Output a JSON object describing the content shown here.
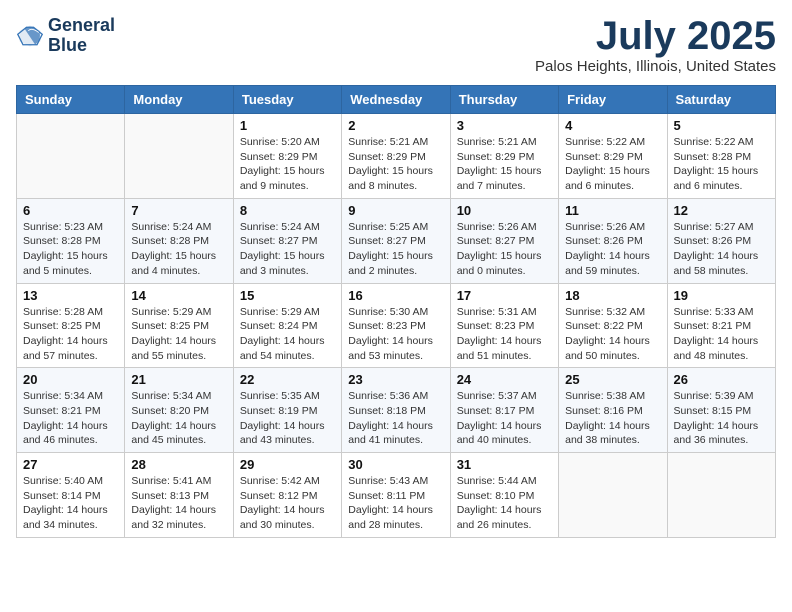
{
  "header": {
    "logo": {
      "line1": "General",
      "line2": "Blue"
    },
    "month": "July 2025",
    "location": "Palos Heights, Illinois, United States"
  },
  "days_of_week": [
    "Sunday",
    "Monday",
    "Tuesday",
    "Wednesday",
    "Thursday",
    "Friday",
    "Saturday"
  ],
  "weeks": [
    [
      {
        "day": "",
        "info": ""
      },
      {
        "day": "",
        "info": ""
      },
      {
        "day": "1",
        "info": "Sunrise: 5:20 AM\nSunset: 8:29 PM\nDaylight: 15 hours and 9 minutes."
      },
      {
        "day": "2",
        "info": "Sunrise: 5:21 AM\nSunset: 8:29 PM\nDaylight: 15 hours and 8 minutes."
      },
      {
        "day": "3",
        "info": "Sunrise: 5:21 AM\nSunset: 8:29 PM\nDaylight: 15 hours and 7 minutes."
      },
      {
        "day": "4",
        "info": "Sunrise: 5:22 AM\nSunset: 8:29 PM\nDaylight: 15 hours and 6 minutes."
      },
      {
        "day": "5",
        "info": "Sunrise: 5:22 AM\nSunset: 8:28 PM\nDaylight: 15 hours and 6 minutes."
      }
    ],
    [
      {
        "day": "6",
        "info": "Sunrise: 5:23 AM\nSunset: 8:28 PM\nDaylight: 15 hours and 5 minutes."
      },
      {
        "day": "7",
        "info": "Sunrise: 5:24 AM\nSunset: 8:28 PM\nDaylight: 15 hours and 4 minutes."
      },
      {
        "day": "8",
        "info": "Sunrise: 5:24 AM\nSunset: 8:27 PM\nDaylight: 15 hours and 3 minutes."
      },
      {
        "day": "9",
        "info": "Sunrise: 5:25 AM\nSunset: 8:27 PM\nDaylight: 15 hours and 2 minutes."
      },
      {
        "day": "10",
        "info": "Sunrise: 5:26 AM\nSunset: 8:27 PM\nDaylight: 15 hours and 0 minutes."
      },
      {
        "day": "11",
        "info": "Sunrise: 5:26 AM\nSunset: 8:26 PM\nDaylight: 14 hours and 59 minutes."
      },
      {
        "day": "12",
        "info": "Sunrise: 5:27 AM\nSunset: 8:26 PM\nDaylight: 14 hours and 58 minutes."
      }
    ],
    [
      {
        "day": "13",
        "info": "Sunrise: 5:28 AM\nSunset: 8:25 PM\nDaylight: 14 hours and 57 minutes."
      },
      {
        "day": "14",
        "info": "Sunrise: 5:29 AM\nSunset: 8:25 PM\nDaylight: 14 hours and 55 minutes."
      },
      {
        "day": "15",
        "info": "Sunrise: 5:29 AM\nSunset: 8:24 PM\nDaylight: 14 hours and 54 minutes."
      },
      {
        "day": "16",
        "info": "Sunrise: 5:30 AM\nSunset: 8:23 PM\nDaylight: 14 hours and 53 minutes."
      },
      {
        "day": "17",
        "info": "Sunrise: 5:31 AM\nSunset: 8:23 PM\nDaylight: 14 hours and 51 minutes."
      },
      {
        "day": "18",
        "info": "Sunrise: 5:32 AM\nSunset: 8:22 PM\nDaylight: 14 hours and 50 minutes."
      },
      {
        "day": "19",
        "info": "Sunrise: 5:33 AM\nSunset: 8:21 PM\nDaylight: 14 hours and 48 minutes."
      }
    ],
    [
      {
        "day": "20",
        "info": "Sunrise: 5:34 AM\nSunset: 8:21 PM\nDaylight: 14 hours and 46 minutes."
      },
      {
        "day": "21",
        "info": "Sunrise: 5:34 AM\nSunset: 8:20 PM\nDaylight: 14 hours and 45 minutes."
      },
      {
        "day": "22",
        "info": "Sunrise: 5:35 AM\nSunset: 8:19 PM\nDaylight: 14 hours and 43 minutes."
      },
      {
        "day": "23",
        "info": "Sunrise: 5:36 AM\nSunset: 8:18 PM\nDaylight: 14 hours and 41 minutes."
      },
      {
        "day": "24",
        "info": "Sunrise: 5:37 AM\nSunset: 8:17 PM\nDaylight: 14 hours and 40 minutes."
      },
      {
        "day": "25",
        "info": "Sunrise: 5:38 AM\nSunset: 8:16 PM\nDaylight: 14 hours and 38 minutes."
      },
      {
        "day": "26",
        "info": "Sunrise: 5:39 AM\nSunset: 8:15 PM\nDaylight: 14 hours and 36 minutes."
      }
    ],
    [
      {
        "day": "27",
        "info": "Sunrise: 5:40 AM\nSunset: 8:14 PM\nDaylight: 14 hours and 34 minutes."
      },
      {
        "day": "28",
        "info": "Sunrise: 5:41 AM\nSunset: 8:13 PM\nDaylight: 14 hours and 32 minutes."
      },
      {
        "day": "29",
        "info": "Sunrise: 5:42 AM\nSunset: 8:12 PM\nDaylight: 14 hours and 30 minutes."
      },
      {
        "day": "30",
        "info": "Sunrise: 5:43 AM\nSunset: 8:11 PM\nDaylight: 14 hours and 28 minutes."
      },
      {
        "day": "31",
        "info": "Sunrise: 5:44 AM\nSunset: 8:10 PM\nDaylight: 14 hours and 26 minutes."
      },
      {
        "day": "",
        "info": ""
      },
      {
        "day": "",
        "info": ""
      }
    ]
  ]
}
